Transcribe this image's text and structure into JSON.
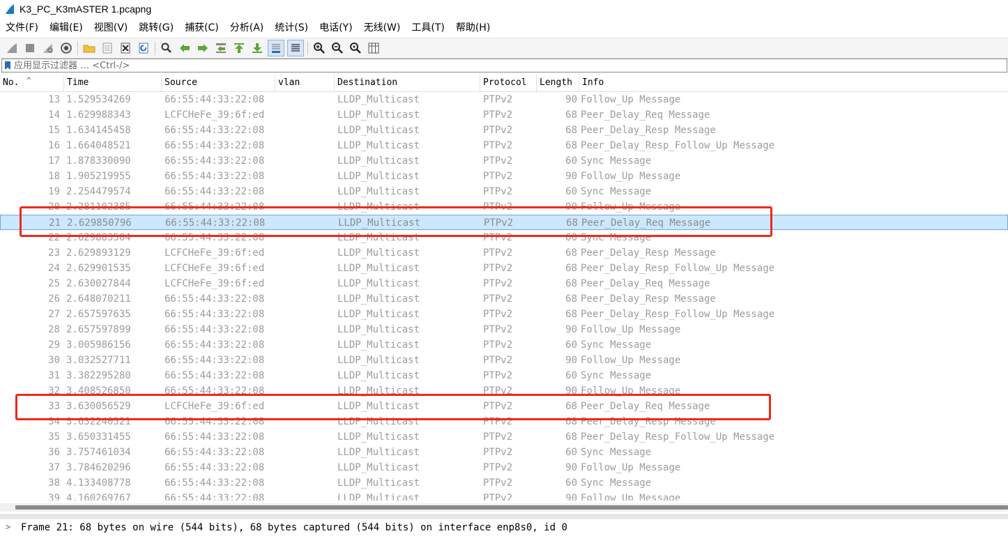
{
  "window": {
    "title": "K3_PC_K3mASTER 1.pcapng"
  },
  "menu": [
    "文件(F)",
    "编辑(E)",
    "视图(V)",
    "跳转(G)",
    "捕获(C)",
    "分析(A)",
    "统计(S)",
    "电话(Y)",
    "无线(W)",
    "工具(T)",
    "帮助(H)"
  ],
  "toolbar": {
    "icons": [
      "shark-fin-start-icon",
      "stop-icon",
      "restart-icon",
      "options-gear-icon",
      "open-folder-icon",
      "save-file-icon",
      "close-file-icon",
      "reload-icon",
      "find-icon",
      "go-back-icon",
      "go-forward-icon",
      "go-to-packet-icon",
      "go-first-icon",
      "go-last-icon",
      "autoscroll-icon",
      "colorize-icon",
      "zoom-in-icon",
      "zoom-out-icon",
      "zoom-normal-icon",
      "resize-columns-icon"
    ]
  },
  "filter": {
    "placeholder": "应用显示过滤器 … <Ctrl-/>"
  },
  "columns": {
    "no": "No.",
    "time": "Time",
    "source": "Source",
    "vlan": "vlan",
    "destination": "Destination",
    "protocol": "Protocol",
    "length": "Length",
    "info": "Info"
  },
  "packets": [
    {
      "no": "13",
      "time": "1.529534269",
      "source": "66:55:44:33:22:08",
      "destination": "LLDP_Multicast",
      "protocol": "PTPv2",
      "length": "90",
      "info": "Follow_Up Message"
    },
    {
      "no": "14",
      "time": "1.629988343",
      "source": "LCFCHeFe_39:6f:ed",
      "destination": "LLDP_Multicast",
      "protocol": "PTPv2",
      "length": "68",
      "info": "Peer_Delay_Req Message"
    },
    {
      "no": "15",
      "time": "1.634145458",
      "source": "66:55:44:33:22:08",
      "destination": "LLDP_Multicast",
      "protocol": "PTPv2",
      "length": "68",
      "info": "Peer_Delay_Resp Message"
    },
    {
      "no": "16",
      "time": "1.664048521",
      "source": "66:55:44:33:22:08",
      "destination": "LLDP_Multicast",
      "protocol": "PTPv2",
      "length": "68",
      "info": "Peer_Delay_Resp_Follow_Up Message"
    },
    {
      "no": "17",
      "time": "1.878330090",
      "source": "66:55:44:33:22:08",
      "destination": "LLDP_Multicast",
      "protocol": "PTPv2",
      "length": "60",
      "info": "Sync Message"
    },
    {
      "no": "18",
      "time": "1.905219955",
      "source": "66:55:44:33:22:08",
      "destination": "LLDP_Multicast",
      "protocol": "PTPv2",
      "length": "90",
      "info": "Follow_Up Message"
    },
    {
      "no": "19",
      "time": "2.254479574",
      "source": "66:55:44:33:22:08",
      "destination": "LLDP_Multicast",
      "protocol": "PTPv2",
      "length": "60",
      "info": "Sync Message"
    },
    {
      "no": "20",
      "time": "2.281102385",
      "source": "66:55:44:33:22:08",
      "destination": "LLDP_Multicast",
      "protocol": "PTPv2",
      "length": "90",
      "info": "Follow_Up Message"
    },
    {
      "no": "21",
      "time": "2.629850796",
      "source": "66:55:44:33:22:08",
      "destination": "LLDP_Multicast",
      "protocol": "PTPv2",
      "length": "68",
      "info": "Peer_Delay_Req Message",
      "selected": true
    },
    {
      "no": "22",
      "time": "2.629883504",
      "source": "66:55:44:33:22:08",
      "destination": "LLDP_Multicast",
      "protocol": "PTPv2",
      "length": "60",
      "info": "Sync Message"
    },
    {
      "no": "23",
      "time": "2.629893129",
      "source": "LCFCHeFe_39:6f:ed",
      "destination": "LLDP_Multicast",
      "protocol": "PTPv2",
      "length": "68",
      "info": "Peer_Delay_Resp Message"
    },
    {
      "no": "24",
      "time": "2.629901535",
      "source": "LCFCHeFe_39:6f:ed",
      "destination": "LLDP_Multicast",
      "protocol": "PTPv2",
      "length": "68",
      "info": "Peer_Delay_Resp_Follow_Up Message"
    },
    {
      "no": "25",
      "time": "2.630027844",
      "source": "LCFCHeFe_39:6f:ed",
      "destination": "LLDP_Multicast",
      "protocol": "PTPv2",
      "length": "68",
      "info": "Peer_Delay_Req Message"
    },
    {
      "no": "26",
      "time": "2.648070211",
      "source": "66:55:44:33:22:08",
      "destination": "LLDP_Multicast",
      "protocol": "PTPv2",
      "length": "68",
      "info": "Peer_Delay_Resp Message"
    },
    {
      "no": "27",
      "time": "2.657597635",
      "source": "66:55:44:33:22:08",
      "destination": "LLDP_Multicast",
      "protocol": "PTPv2",
      "length": "68",
      "info": "Peer_Delay_Resp_Follow_Up Message"
    },
    {
      "no": "28",
      "time": "2.657597899",
      "source": "66:55:44:33:22:08",
      "destination": "LLDP_Multicast",
      "protocol": "PTPv2",
      "length": "90",
      "info": "Follow_Up Message"
    },
    {
      "no": "29",
      "time": "3.005986156",
      "source": "66:55:44:33:22:08",
      "destination": "LLDP_Multicast",
      "protocol": "PTPv2",
      "length": "60",
      "info": "Sync Message"
    },
    {
      "no": "30",
      "time": "3.032527711",
      "source": "66:55:44:33:22:08",
      "destination": "LLDP_Multicast",
      "protocol": "PTPv2",
      "length": "90",
      "info": "Follow_Up Message"
    },
    {
      "no": "31",
      "time": "3.382295280",
      "source": "66:55:44:33:22:08",
      "destination": "LLDP_Multicast",
      "protocol": "PTPv2",
      "length": "60",
      "info": "Sync Message"
    },
    {
      "no": "32",
      "time": "3.408526850",
      "source": "66:55:44:33:22:08",
      "destination": "LLDP_Multicast",
      "protocol": "PTPv2",
      "length": "90",
      "info": "Follow_Up Message"
    },
    {
      "no": "33",
      "time": "3.630056529",
      "source": "LCFCHeFe_39:6f:ed",
      "destination": "LLDP_Multicast",
      "protocol": "PTPv2",
      "length": "68",
      "info": "Peer_Delay_Req Message"
    },
    {
      "no": "34",
      "time": "3.632240521",
      "source": "66:55:44:33:22:08",
      "destination": "LLDP_Multicast",
      "protocol": "PTPv2",
      "length": "68",
      "info": "Peer_Delay_Resp Message"
    },
    {
      "no": "35",
      "time": "3.650331455",
      "source": "66:55:44:33:22:08",
      "destination": "LLDP_Multicast",
      "protocol": "PTPv2",
      "length": "68",
      "info": "Peer_Delay_Resp_Follow_Up Message"
    },
    {
      "no": "36",
      "time": "3.757461034",
      "source": "66:55:44:33:22:08",
      "destination": "LLDP_Multicast",
      "protocol": "PTPv2",
      "length": "60",
      "info": "Sync Message"
    },
    {
      "no": "37",
      "time": "3.784620296",
      "source": "66:55:44:33:22:08",
      "destination": "LLDP_Multicast",
      "protocol": "PTPv2",
      "length": "90",
      "info": "Follow_Up Message"
    },
    {
      "no": "38",
      "time": "4.133408778",
      "source": "66:55:44:33:22:08",
      "destination": "LLDP_Multicast",
      "protocol": "PTPv2",
      "length": "60",
      "info": "Sync Message"
    },
    {
      "no": "39",
      "time": "4.160269767",
      "source": "66:55:44:33:22:08",
      "destination": "LLDP_Multicast",
      "protocol": "PTPv2",
      "length": "90",
      "info": "Follow_Up Message"
    }
  ],
  "detail": {
    "line": "Frame 21: 68 bytes on wire (544 bits), 68 bytes captured (544 bits) on interface enp8s0, id 0"
  },
  "colors": {
    "selected_row": "#cce8ff",
    "annotation": "#f0281e",
    "row_text": "#9c9c9c"
  }
}
